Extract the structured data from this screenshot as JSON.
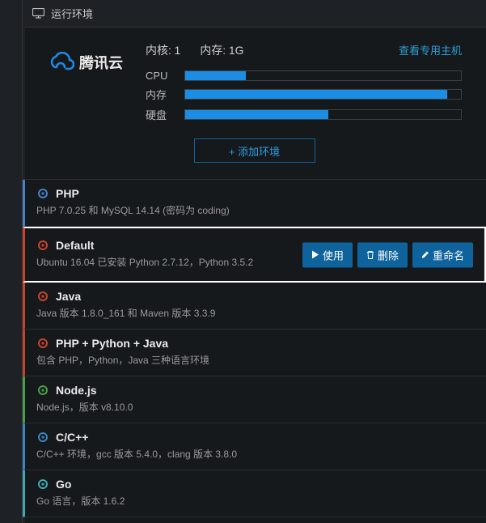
{
  "header": {
    "title": "运行环境"
  },
  "brand": {
    "name": "腾讯云"
  },
  "specs": {
    "cores_label": "内核:",
    "cores_value": "1",
    "mem_label": "内存:",
    "mem_value": "1G",
    "view_link": "查看专用主机"
  },
  "bars": {
    "cpu": {
      "label": "CPU",
      "pct": 22
    },
    "mem": {
      "label": "内存",
      "pct": 95
    },
    "disk": {
      "label": "硬盘",
      "pct": 52
    }
  },
  "chart_data": {
    "type": "bar",
    "categories": [
      "CPU",
      "内存",
      "硬盘"
    ],
    "values": [
      22,
      95,
      52
    ],
    "ylim": [
      0,
      100
    ],
    "title": "",
    "xlabel": "",
    "ylabel": ""
  },
  "add_env": {
    "label": "+ 添加环境"
  },
  "actions": {
    "use": "使用",
    "delete": "删除",
    "rename": "重命名"
  },
  "envs": [
    {
      "name": "PHP",
      "desc": "PHP 7.0.25 和 MySQL 14.14 (密码为 coding)",
      "color": "#4a7fc9",
      "selected": false
    },
    {
      "name": "Default",
      "desc": "Ubuntu 16.04 已安装 Python 2.7.12，Python 3.5.2",
      "color": "#c8432f",
      "selected": true
    },
    {
      "name": "Java",
      "desc": "Java 版本 1.8.0_161 和 Maven 版本 3.3.9",
      "color": "#c8432f",
      "selected": false
    },
    {
      "name": "PHP + Python + Java",
      "desc": "包含 PHP，Python，Java 三种语言环境",
      "color": "#c8432f",
      "selected": false
    },
    {
      "name": "Node.js",
      "desc": "Node.js，版本 v8.10.0",
      "color": "#4a9e4a",
      "selected": false
    },
    {
      "name": "C/C++",
      "desc": "C/C++ 环境，gcc 版本 5.4.0，clang 版本 3.8.0",
      "color": "#3b84c5",
      "selected": false
    },
    {
      "name": "Go",
      "desc": "Go 语言，版本 1.6.2",
      "color": "#3fa8b5",
      "selected": false
    }
  ]
}
